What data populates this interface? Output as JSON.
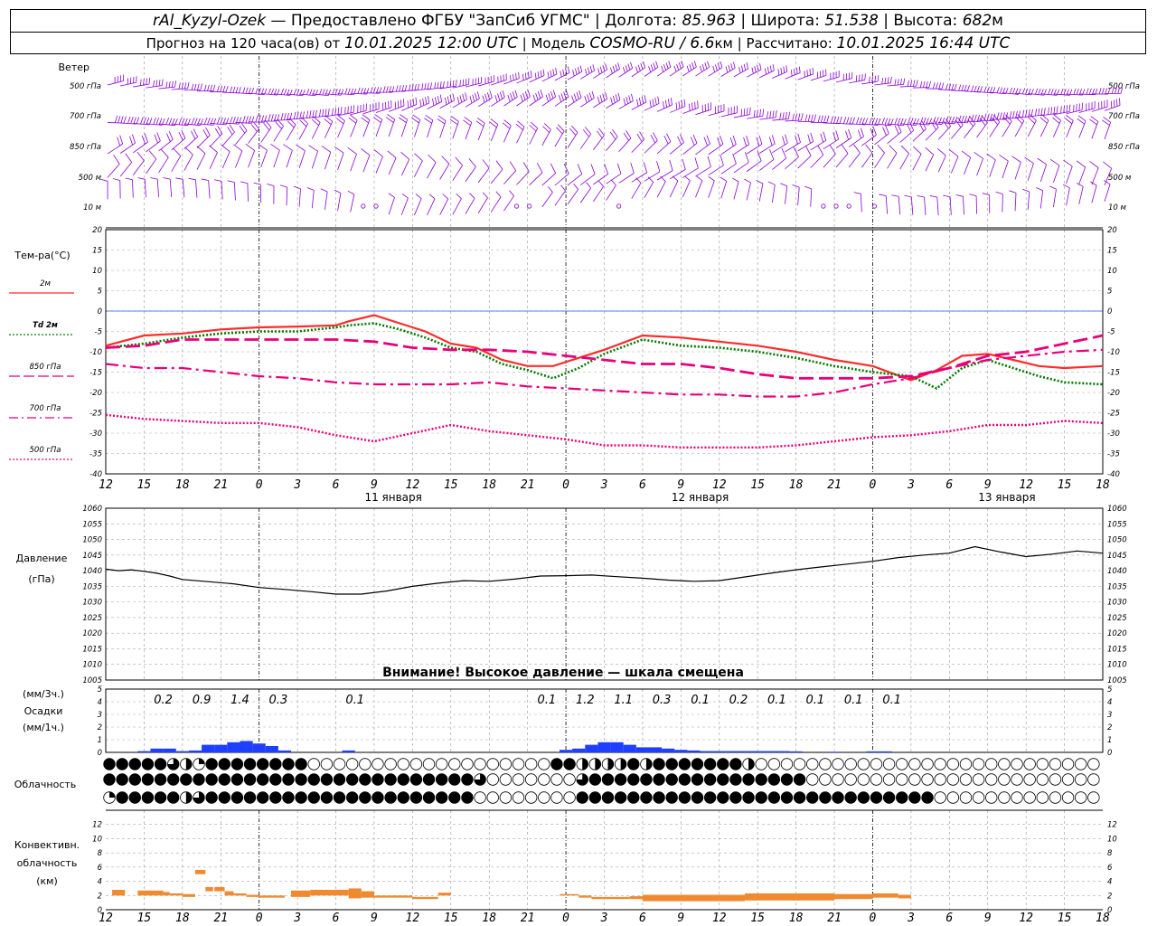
{
  "header": {
    "line1": {
      "station": "rAl_Kyzyl-Ozek",
      "provider": "— Предоставлено ФГБУ \"ЗапСиб УГМС\"",
      "lon_label": "Долгота:",
      "lon_value": "85.963",
      "lat_label": "Широта:",
      "lat_value": "51.538",
      "alt_label": "Высота:",
      "alt_value": "682",
      "alt_unit": "м"
    },
    "line2": {
      "forecast_prefix": "Прогноз на 120 часа(ов) от",
      "issued": "10.01.2025 12:00 UTC",
      "model_label": "Модель",
      "model": "COSMO-RU / 6.6",
      "model_unit": "км",
      "calc_label": "Рассчитано:",
      "calc": "10.01.2025 16:44 UTC"
    }
  },
  "labels": {
    "wind_title": "Ветер",
    "wind_levels": [
      "500 гПа",
      "700 гПа",
      "850 гПа",
      "500 м",
      "10  м"
    ],
    "temp_title": "Тем-ра(°C)",
    "pressure_title": "Давление",
    "pressure_unit": "(гПа)",
    "precip_unit3": "(мм/3ч.)",
    "precip_title": "Осадки",
    "precip_unit1": "(мм/1ч.)",
    "cloud_title": "Облачность",
    "conv_title1": "Конвективн.",
    "conv_title2": "облачность",
    "conv_unit": "(км)",
    "warning": "Внимание! Высокое давление — шкала смещена"
  },
  "colors": {
    "wind": "#8a00d4",
    "t2m": "#ff2b2b",
    "td2m": "#007a00",
    "t850": "#e8007a",
    "t700": "#e8007a",
    "t500": "#e8007a",
    "pressure": "#000000",
    "precip": "#1f3fff",
    "conv": "#f08a30",
    "zero": "#2a4bff"
  },
  "chart_data": {
    "type": "meteogram",
    "x_unit": "hours since 10.01.2025 12:00 UTC",
    "x_range": [
      0,
      78
    ],
    "hour_ticks": [
      "12",
      "15",
      "18",
      "21",
      "0",
      "3",
      "6",
      "9",
      "12",
      "15",
      "18",
      "21",
      "0",
      "3",
      "6",
      "9",
      "12",
      "15",
      "18",
      "21",
      "0",
      "3",
      "6",
      "9",
      "12",
      "15",
      "18"
    ],
    "day_labels": [
      {
        "text": "11 января",
        "x": 22.5
      },
      {
        "text": "12 января",
        "x": 46.5
      },
      {
        "text": "13 января",
        "x": 70.5
      }
    ],
    "temperature": {
      "ylim": [
        -40,
        20
      ],
      "yticks": [
        20,
        15,
        10,
        5,
        0,
        -5,
        -10,
        -15,
        -20,
        -25,
        -30,
        -35,
        -40
      ],
      "series": [
        {
          "name": "2м",
          "style": "solid",
          "x": [
            0,
            3,
            6,
            9,
            12,
            15,
            18,
            19,
            21,
            23,
            25,
            27,
            29,
            31,
            33,
            35,
            37,
            39,
            42,
            45,
            48,
            51,
            54,
            57,
            60,
            63,
            65,
            67,
            69,
            71,
            73,
            75,
            78
          ],
          "y": [
            -8.5,
            -6,
            -5.5,
            -4.5,
            -4,
            -3.8,
            -3.5,
            -2.5,
            -1,
            -3,
            -5,
            -8,
            -9,
            -12,
            -13.5,
            -13.5,
            -11.5,
            -9.5,
            -6,
            -6.5,
            -7.5,
            -8.5,
            -10,
            -12,
            -13.5,
            -17,
            -14.5,
            -11,
            -10.5,
            -12,
            -13.5,
            -14,
            -13.5
          ]
        },
        {
          "name": "Td 2м",
          "style": "dotted",
          "x": [
            0,
            3,
            6,
            9,
            12,
            15,
            18,
            19,
            21,
            23,
            25,
            27,
            29,
            31,
            33,
            35,
            37,
            39,
            42,
            45,
            48,
            51,
            54,
            57,
            60,
            63,
            65,
            67,
            69,
            71,
            73,
            75,
            78
          ],
          "y": [
            -9,
            -8,
            -6.5,
            -5.5,
            -5,
            -5,
            -4,
            -3.5,
            -3,
            -4.5,
            -6.5,
            -9,
            -10,
            -13,
            -14.5,
            -16.5,
            -14,
            -10.5,
            -7,
            -8.5,
            -9,
            -10,
            -11.5,
            -13.5,
            -15,
            -16,
            -19,
            -14,
            -12,
            -14,
            -16,
            -17.5,
            -18
          ]
        },
        {
          "name": "850 гПа",
          "style": "dashed",
          "x": [
            0,
            3,
            6,
            9,
            12,
            15,
            18,
            21,
            24,
            27,
            30,
            33,
            36,
            39,
            42,
            45,
            48,
            51,
            54,
            57,
            60,
            63,
            66,
            69,
            72,
            75,
            78
          ],
          "y": [
            -9,
            -8.5,
            -7,
            -7,
            -7,
            -7,
            -7,
            -7.5,
            -9,
            -9.5,
            -9.5,
            -10,
            -11,
            -12,
            -13,
            -13,
            -14,
            -15.5,
            -16.5,
            -16.5,
            -16.5,
            -16,
            -14,
            -11,
            -10,
            -8,
            -6
          ]
        },
        {
          "name": "700 гПа",
          "style": "dashdot",
          "x": [
            0,
            3,
            6,
            9,
            12,
            15,
            18,
            21,
            24,
            27,
            30,
            33,
            36,
            39,
            42,
            45,
            48,
            51,
            54,
            57,
            60,
            63,
            66,
            69,
            72,
            75,
            78
          ],
          "y": [
            -13,
            -14,
            -14,
            -15,
            -16,
            -16.5,
            -17.5,
            -18,
            -18,
            -18,
            -17.5,
            -18.5,
            -19,
            -19.5,
            -20,
            -20.5,
            -20.5,
            -21,
            -21,
            -20,
            -18,
            -16.5,
            -14,
            -12,
            -11,
            -10,
            -9.5
          ]
        },
        {
          "name": "500 гПа",
          "style": "dotted",
          "x": [
            0,
            3,
            6,
            9,
            12,
            15,
            18,
            21,
            24,
            27,
            30,
            33,
            36,
            39,
            42,
            45,
            48,
            51,
            54,
            57,
            60,
            63,
            66,
            69,
            72,
            75,
            78
          ],
          "y": [
            -25.5,
            -26.5,
            -27,
            -27.5,
            -27.5,
            -28.5,
            -30.5,
            -32,
            -30,
            -28,
            -29.5,
            -30.5,
            -31.5,
            -33,
            -33,
            -33.5,
            -33.5,
            -33.5,
            -33,
            -32,
            -31,
            -30.5,
            -29.5,
            -28,
            -28,
            -27,
            -27.5
          ]
        }
      ]
    },
    "pressure": {
      "ylim": [
        1005,
        1060
      ],
      "yticks": [
        1060,
        1055,
        1050,
        1045,
        1040,
        1035,
        1030,
        1025,
        1020,
        1015,
        1010,
        1005
      ],
      "x": [
        0,
        1,
        2,
        3,
        4,
        5,
        6,
        8,
        10,
        12,
        14,
        16,
        18,
        20,
        22,
        24,
        26,
        28,
        30,
        32,
        34,
        36,
        38,
        40,
        42,
        44,
        46,
        48,
        50,
        52,
        54,
        56,
        58,
        60,
        62,
        64,
        66,
        68,
        70,
        72,
        74,
        76,
        78
      ],
      "y": [
        1040.5,
        1040,
        1040.3,
        1039.8,
        1039.2,
        1038.3,
        1037.2,
        1036.5,
        1035.8,
        1034.6,
        1034,
        1033.3,
        1032.5,
        1032.5,
        1033.5,
        1035,
        1036,
        1036.8,
        1036.6,
        1037.3,
        1038.3,
        1038.4,
        1038.6,
        1038.1,
        1037.6,
        1037,
        1036.6,
        1036.8,
        1038,
        1039.2,
        1040.3,
        1041.2,
        1042.1,
        1043,
        1044.2,
        1045,
        1045.6,
        1047.7,
        1046,
        1044.5,
        1045.3,
        1046.3,
        1045.6
      ]
    },
    "precipitation": {
      "ylim": [
        0,
        5
      ],
      "yticks": [
        5,
        4,
        3,
        2,
        1,
        0
      ],
      "bars": [
        {
          "x": 3,
          "v": 0.1
        },
        {
          "x": 4,
          "v": 0.3
        },
        {
          "x": 5,
          "v": 0.3
        },
        {
          "x": 6,
          "v": 0.1
        },
        {
          "x": 7,
          "v": 0.15
        },
        {
          "x": 8,
          "v": 0.6
        },
        {
          "x": 9,
          "v": 0.6
        },
        {
          "x": 10,
          "v": 0.8
        },
        {
          "x": 11,
          "v": 0.9
        },
        {
          "x": 12,
          "v": 0.7
        },
        {
          "x": 13,
          "v": 0.5
        },
        {
          "x": 14,
          "v": 0.15
        },
        {
          "x": 19,
          "v": 0.15
        },
        {
          "x": 36,
          "v": 0.2
        },
        {
          "x": 37,
          "v": 0.3
        },
        {
          "x": 38,
          "v": 0.6
        },
        {
          "x": 39,
          "v": 0.8
        },
        {
          "x": 40,
          "v": 0.8
        },
        {
          "x": 41,
          "v": 0.6
        },
        {
          "x": 42,
          "v": 0.4
        },
        {
          "x": 43,
          "v": 0.4
        },
        {
          "x": 44,
          "v": 0.3
        },
        {
          "x": 45,
          "v": 0.2
        },
        {
          "x": 46,
          "v": 0.15
        },
        {
          "x": 47,
          "v": 0.1
        },
        {
          "x": 48,
          "v": 0.1
        },
        {
          "x": 49,
          "v": 0.1
        },
        {
          "x": 50,
          "v": 0.1
        },
        {
          "x": 51,
          "v": 0.1
        },
        {
          "x": 52,
          "v": 0.1
        },
        {
          "x": 53,
          "v": 0.1
        },
        {
          "x": 54,
          "v": 0.08
        },
        {
          "x": 57,
          "v": 0.05
        },
        {
          "x": 60,
          "v": 0.08
        },
        {
          "x": 61,
          "v": 0.08
        }
      ],
      "amounts_3h": [
        {
          "x": 4.5,
          "text": "0.2"
        },
        {
          "x": 7.5,
          "text": "0.9"
        },
        {
          "x": 10.5,
          "text": "1.4"
        },
        {
          "x": 13.5,
          "text": "0.3"
        },
        {
          "x": 19.5,
          "text": "0.1"
        },
        {
          "x": 34.5,
          "text": "0.1"
        },
        {
          "x": 37.5,
          "text": "1.2"
        },
        {
          "x": 40.5,
          "text": "1.1"
        },
        {
          "x": 43.5,
          "text": "0.3"
        },
        {
          "x": 46.5,
          "text": "0.1"
        },
        {
          "x": 49.5,
          "text": "0.2"
        },
        {
          "x": 52.5,
          "text": "0.1"
        },
        {
          "x": 55.5,
          "text": "0.1"
        },
        {
          "x": 58.5,
          "text": "0.1"
        },
        {
          "x": 61.5,
          "text": "0.1"
        }
      ]
    },
    "cloudiness": {
      "x_start": 0,
      "x_step": 1,
      "rows": [
        "444443214444444400000000000000000004422224244444442000000000000000000000000000",
        "444444444444444444444444444443000000034444444444444444400000000000000000000000",
        "144444234444444444444444444440000000044444444444444444444444444440000000000000"
      ]
    },
    "convective_cloud": {
      "ylim": [
        0,
        14
      ],
      "yticks": [
        12,
        10,
        8,
        6,
        4,
        2,
        0
      ],
      "bars": [
        {
          "x0": 0.5,
          "x1": 1.5,
          "bot": 2,
          "top": 2.8
        },
        {
          "x0": 2.5,
          "x1": 4.5,
          "bot": 2,
          "top": 2.7
        },
        {
          "x0": 4.5,
          "x1": 5,
          "bot": 2,
          "top": 2.5
        },
        {
          "x0": 5,
          "x1": 6,
          "bot": 2,
          "top": 2.3
        },
        {
          "x0": 6,
          "x1": 7,
          "bot": 1.8,
          "top": 2.2
        },
        {
          "x0": 7,
          "x1": 7.8,
          "bot": 5,
          "top": 5.6
        },
        {
          "x0": 7.8,
          "x1": 8.4,
          "bot": 2.6,
          "top": 3.2
        },
        {
          "x0": 8.5,
          "x1": 9.3,
          "bot": 2.6,
          "top": 3.2
        },
        {
          "x0": 9.3,
          "x1": 10,
          "bot": 2,
          "top": 2.6
        },
        {
          "x0": 10,
          "x1": 11,
          "bot": 2,
          "top": 2.3
        },
        {
          "x0": 11,
          "x1": 12,
          "bot": 1.8,
          "top": 2.1
        },
        {
          "x0": 12,
          "x1": 14,
          "bot": 1.7,
          "top": 2
        },
        {
          "x0": 14.5,
          "x1": 16,
          "bot": 1.8,
          "top": 2.7
        },
        {
          "x0": 16,
          "x1": 19,
          "bot": 2,
          "top": 2.8
        },
        {
          "x0": 19,
          "x1": 20,
          "bot": 1.6,
          "top": 3
        },
        {
          "x0": 20,
          "x1": 21,
          "bot": 1.7,
          "top": 2.6
        },
        {
          "x0": 21,
          "x1": 24,
          "bot": 1.7,
          "top": 2
        },
        {
          "x0": 24,
          "x1": 26,
          "bot": 1.5,
          "top": 1.8
        },
        {
          "x0": 26,
          "x1": 27,
          "bot": 2,
          "top": 2.4
        },
        {
          "x0": 35.5,
          "x1": 37,
          "bot": 2,
          "top": 2.2
        },
        {
          "x0": 37,
          "x1": 38,
          "bot": 1.7,
          "top": 2
        },
        {
          "x0": 38,
          "x1": 41,
          "bot": 1.5,
          "top": 1.8
        },
        {
          "x0": 41,
          "x1": 42,
          "bot": 1.5,
          "top": 1.9
        },
        {
          "x0": 42,
          "x1": 50,
          "bot": 1.2,
          "top": 2.1
        },
        {
          "x0": 50,
          "x1": 57,
          "bot": 1.3,
          "top": 2.3
        },
        {
          "x0": 57,
          "x1": 60,
          "bot": 1.5,
          "top": 2.2
        },
        {
          "x0": 60,
          "x1": 62,
          "bot": 1.7,
          "top": 2.3
        },
        {
          "x0": 62,
          "x1": 63,
          "bot": 1.6,
          "top": 2.1
        }
      ]
    },
    "wind_barbs": {
      "levels": [
        "500 гПа",
        "700 гПа",
        "850 гПа",
        "500 м",
        "10  м"
      ],
      "x_step": 1
    }
  }
}
